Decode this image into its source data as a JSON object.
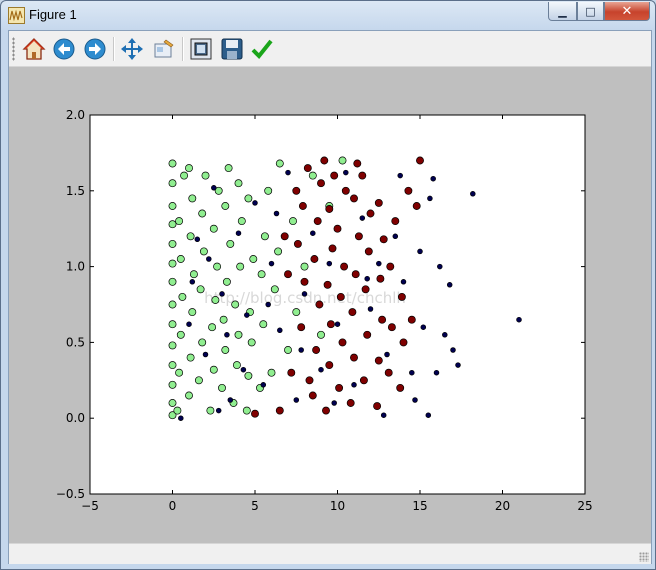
{
  "window": {
    "title": "Figure 1",
    "minimize_glyph": "▁",
    "maximize_glyph": "□",
    "close_glyph": "✕"
  },
  "toolbar": {
    "buttons": [
      {
        "id": "home",
        "icon": "home-icon"
      },
      {
        "id": "back",
        "icon": "back-arrow-icon"
      },
      {
        "id": "forward",
        "icon": "forward-arrow-icon"
      },
      {
        "id": "pan",
        "icon": "pan-move-icon"
      },
      {
        "id": "zoom",
        "icon": "zoom-rect-icon"
      },
      {
        "id": "subplots",
        "icon": "subplots-config-icon"
      },
      {
        "id": "save",
        "icon": "save-floppy-icon"
      },
      {
        "id": "edit",
        "icon": "edit-check-icon"
      }
    ]
  },
  "watermark": "http://blog.csdn.net/chchlh",
  "colors": {
    "class_0": "#90ee90",
    "class_1": "#7f0000",
    "class_2": "#000050"
  },
  "chart_data": {
    "type": "scatter",
    "title": "",
    "xlabel": "",
    "ylabel": "",
    "xlim": [
      -5,
      25
    ],
    "ylim": [
      -0.5,
      2.0
    ],
    "xticks": [
      -5,
      0,
      5,
      10,
      15,
      20,
      25
    ],
    "yticks": [
      -0.5,
      0.0,
      0.5,
      1.0,
      1.5,
      2.0
    ],
    "xtick_labels": [
      "−5",
      "0",
      "5",
      "10",
      "15",
      "20",
      "25"
    ],
    "ytick_labels": [
      "−0.5",
      "0.0",
      "0.5",
      "1.0",
      "1.5",
      "2.0"
    ],
    "grid": false,
    "legend": "none",
    "series": [
      {
        "color": "#90ee90",
        "marker_size": "large",
        "points": [
          [
            0,
            0.02
          ],
          [
            0,
            0.1
          ],
          [
            0,
            0.22
          ],
          [
            0,
            0.35
          ],
          [
            0,
            0.48
          ],
          [
            0,
            0.62
          ],
          [
            0,
            0.75
          ],
          [
            0,
            0.9
          ],
          [
            0,
            1.02
          ],
          [
            0,
            1.15
          ],
          [
            0,
            1.28
          ],
          [
            0,
            1.4
          ],
          [
            0,
            1.55
          ],
          [
            0,
            1.68
          ],
          [
            0.3,
            0.05
          ],
          [
            0.4,
            0.3
          ],
          [
            0.5,
            0.55
          ],
          [
            0.6,
            0.8
          ],
          [
            0.5,
            1.05
          ],
          [
            0.4,
            1.3
          ],
          [
            0.7,
            1.6
          ],
          [
            1.0,
            0.15
          ],
          [
            1.1,
            0.4
          ],
          [
            1.2,
            0.7
          ],
          [
            1.3,
            0.95
          ],
          [
            1.1,
            1.2
          ],
          [
            1.2,
            1.45
          ],
          [
            1.0,
            1.65
          ],
          [
            1.6,
            0.25
          ],
          [
            1.8,
            0.5
          ],
          [
            1.7,
            0.85
          ],
          [
            1.9,
            1.1
          ],
          [
            1.8,
            1.35
          ],
          [
            2.0,
            1.6
          ],
          [
            2.3,
            0.05
          ],
          [
            2.5,
            0.32
          ],
          [
            2.4,
            0.6
          ],
          [
            2.6,
            0.78
          ],
          [
            2.7,
            1.0
          ],
          [
            2.5,
            1.25
          ],
          [
            2.8,
            1.5
          ],
          [
            3.0,
            0.2
          ],
          [
            3.2,
            0.45
          ],
          [
            3.1,
            0.65
          ],
          [
            3.3,
            0.9
          ],
          [
            3.5,
            1.15
          ],
          [
            3.2,
            1.4
          ],
          [
            3.4,
            1.65
          ],
          [
            3.7,
            0.1
          ],
          [
            3.9,
            0.35
          ],
          [
            4.0,
            0.55
          ],
          [
            3.8,
            0.75
          ],
          [
            4.1,
            1.0
          ],
          [
            4.2,
            1.3
          ],
          [
            4.0,
            1.55
          ],
          [
            4.5,
            0.05
          ],
          [
            4.6,
            0.28
          ],
          [
            4.8,
            0.5
          ],
          [
            4.7,
            0.7
          ],
          [
            4.9,
            1.05
          ],
          [
            4.6,
            1.45
          ],
          [
            5.3,
            0.2
          ],
          [
            5.5,
            0.62
          ],
          [
            5.4,
            0.95
          ],
          [
            5.6,
            1.2
          ],
          [
            5.8,
            1.5
          ],
          [
            6.0,
            0.3
          ],
          [
            6.2,
            0.85
          ],
          [
            6.4,
            1.1
          ],
          [
            6.5,
            1.68
          ],
          [
            7.0,
            0.45
          ],
          [
            7.3,
            1.3
          ],
          [
            7.5,
            0.7
          ],
          [
            8.0,
            1.0
          ],
          [
            8.5,
            1.6
          ],
          [
            9.0,
            0.55
          ],
          [
            9.5,
            1.4
          ],
          [
            10.3,
            1.7
          ]
        ]
      },
      {
        "color": "#7f0000",
        "marker_size": "large",
        "points": [
          [
            5.0,
            0.03
          ],
          [
            6.5,
            0.05
          ],
          [
            7.2,
            0.3
          ],
          [
            7.8,
            0.6
          ],
          [
            8.0,
            0.9
          ],
          [
            7.6,
            1.15
          ],
          [
            7.9,
            1.4
          ],
          [
            8.2,
            1.65
          ],
          [
            8.5,
            0.15
          ],
          [
            8.7,
            0.45
          ],
          [
            8.9,
            0.75
          ],
          [
            8.6,
            1.05
          ],
          [
            8.8,
            1.3
          ],
          [
            9.0,
            1.55
          ],
          [
            9.3,
            0.05
          ],
          [
            9.5,
            0.35
          ],
          [
            9.6,
            0.62
          ],
          [
            9.4,
            0.88
          ],
          [
            9.7,
            1.12
          ],
          [
            9.5,
            1.38
          ],
          [
            9.8,
            1.6
          ],
          [
            10.1,
            0.2
          ],
          [
            10.3,
            0.5
          ],
          [
            10.2,
            0.8
          ],
          [
            10.4,
            1.0
          ],
          [
            10.0,
            1.25
          ],
          [
            10.5,
            1.5
          ],
          [
            10.8,
            0.1
          ],
          [
            11.0,
            0.4
          ],
          [
            10.9,
            0.7
          ],
          [
            11.1,
            0.95
          ],
          [
            11.3,
            1.2
          ],
          [
            11.0,
            1.45
          ],
          [
            11.2,
            1.68
          ],
          [
            11.6,
            0.25
          ],
          [
            11.8,
            0.55
          ],
          [
            11.7,
            0.85
          ],
          [
            11.9,
            1.1
          ],
          [
            12.0,
            1.35
          ],
          [
            11.5,
            1.6
          ],
          [
            12.4,
            0.08
          ],
          [
            12.5,
            0.38
          ],
          [
            12.7,
            0.65
          ],
          [
            12.6,
            0.92
          ],
          [
            12.8,
            1.18
          ],
          [
            12.5,
            1.42
          ],
          [
            13.1,
            0.3
          ],
          [
            13.3,
            0.6
          ],
          [
            13.2,
            1.0
          ],
          [
            13.5,
            1.3
          ],
          [
            13.8,
            0.2
          ],
          [
            14.0,
            0.5
          ],
          [
            13.9,
            0.8
          ],
          [
            14.3,
            1.5
          ],
          [
            14.5,
            0.65
          ],
          [
            14.8,
            1.4
          ],
          [
            15.0,
            1.7
          ],
          [
            7.0,
            0.95
          ],
          [
            7.5,
            1.5
          ],
          [
            9.2,
            1.7
          ],
          [
            6.8,
            1.2
          ],
          [
            8.3,
            0.25
          ]
        ]
      },
      {
        "color": "#000050",
        "marker_size": "small",
        "points": [
          [
            0.5,
            0.0
          ],
          [
            1.0,
            0.62
          ],
          [
            1.5,
            1.18
          ],
          [
            2.0,
            0.42
          ],
          [
            2.5,
            1.52
          ],
          [
            3.0,
            0.82
          ],
          [
            3.5,
            0.12
          ],
          [
            4.0,
            1.22
          ],
          [
            4.5,
            0.68
          ],
          [
            5.0,
            1.42
          ],
          [
            5.5,
            0.22
          ],
          [
            6.0,
            1.02
          ],
          [
            6.5,
            0.58
          ],
          [
            7.0,
            1.62
          ],
          [
            7.5,
            0.12
          ],
          [
            8.0,
            0.82
          ],
          [
            8.5,
            1.22
          ],
          [
            9.0,
            0.32
          ],
          [
            9.5,
            1.02
          ],
          [
            10.0,
            0.62
          ],
          [
            10.5,
            1.62
          ],
          [
            11.0,
            0.22
          ],
          [
            11.5,
            1.32
          ],
          [
            12.0,
            0.72
          ],
          [
            12.5,
            1.02
          ],
          [
            13.0,
            0.42
          ],
          [
            13.5,
            1.2
          ],
          [
            14.0,
            0.9
          ],
          [
            14.5,
            0.3
          ],
          [
            15.0,
            1.1
          ],
          [
            15.2,
            0.6
          ],
          [
            15.5,
            0.02
          ],
          [
            15.6,
            1.45
          ],
          [
            16.0,
            0.3
          ],
          [
            16.2,
            1.0
          ],
          [
            16.5,
            0.55
          ],
          [
            17.0,
            0.45
          ],
          [
            17.3,
            0.35
          ],
          [
            18.2,
            1.48
          ],
          [
            21.0,
            0.65
          ],
          [
            15.8,
            1.58
          ],
          [
            16.8,
            0.88
          ],
          [
            14.7,
            0.12
          ],
          [
            13.8,
            1.6
          ],
          [
            12.8,
            0.02
          ],
          [
            2.8,
            0.05
          ],
          [
            3.3,
            0.55
          ],
          [
            4.3,
            0.32
          ],
          [
            5.8,
            0.75
          ],
          [
            6.3,
            1.35
          ],
          [
            1.2,
            0.9
          ],
          [
            2.2,
            1.05
          ],
          [
            7.8,
            0.45
          ],
          [
            9.8,
            0.1
          ],
          [
            11.8,
            0.92
          ]
        ]
      }
    ]
  }
}
